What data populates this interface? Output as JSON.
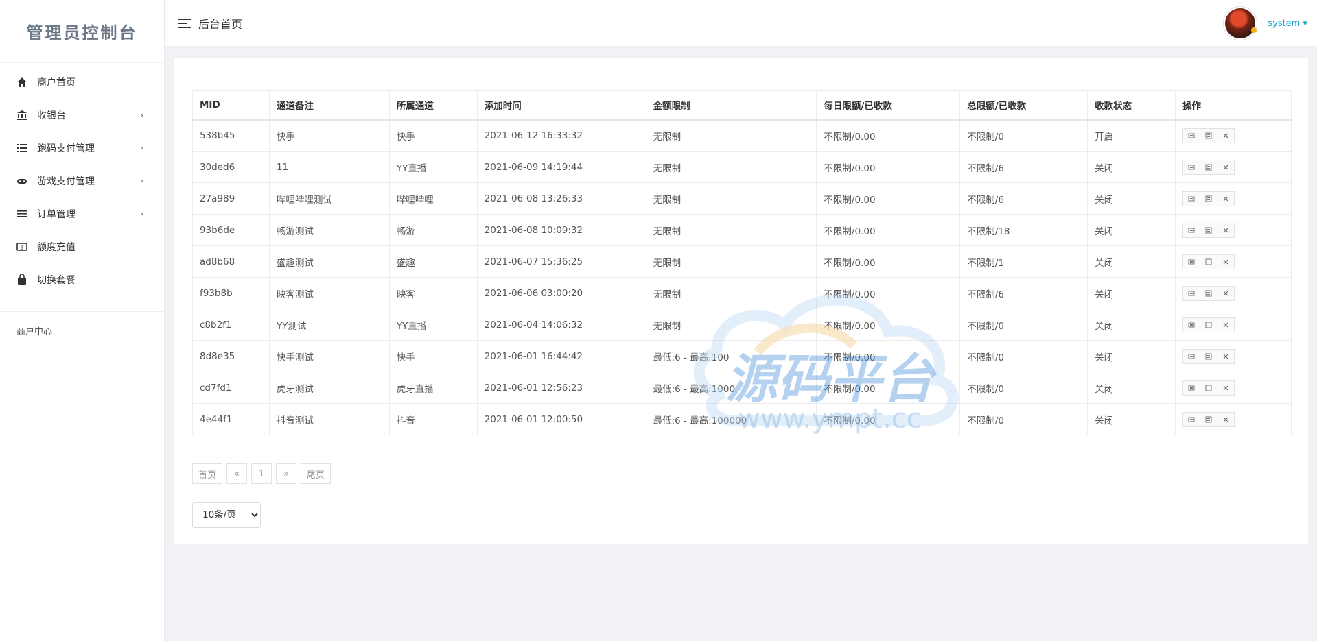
{
  "brand": {
    "title": "管理员控制台"
  },
  "header": {
    "title": "后台首页",
    "username": "system"
  },
  "sidebar": {
    "items": [
      {
        "label": "商户首页",
        "icon": "home-icon",
        "has_children": false
      },
      {
        "label": "收银台",
        "icon": "bank-icon",
        "has_children": true
      },
      {
        "label": "跑码支付管理",
        "icon": "list-icon",
        "has_children": true
      },
      {
        "label": "游戏支付管理",
        "icon": "gamepad-icon",
        "has_children": true
      },
      {
        "label": "订单管理",
        "icon": "menu-lines-icon",
        "has_children": true
      },
      {
        "label": "额度充值",
        "icon": "money-icon",
        "has_children": false
      },
      {
        "label": "切换套餐",
        "icon": "bag-icon",
        "has_children": false
      }
    ],
    "section_label": "商户中心",
    "chevron": "›"
  },
  "table": {
    "columns": [
      "MID",
      "通道备注",
      "所属通道",
      "添加时间",
      "金额限制",
      "每日限额/已收款",
      "总限额/已收款",
      "收款状态",
      "操作"
    ],
    "rows": [
      {
        "mid": "538b45",
        "note": "快手",
        "channel": "快手",
        "time": "2021-06-12 16:33:32",
        "amount": "无限制",
        "daily": "不限制/0.00",
        "total": "不限制/0",
        "status": "开启",
        "status_on": true
      },
      {
        "mid": "30ded6",
        "note": "11",
        "channel": "YY直播",
        "time": "2021-06-09 14:19:44",
        "amount": "无限制",
        "daily": "不限制/0.00",
        "total": "不限制/6",
        "status": "关闭",
        "status_on": false
      },
      {
        "mid": "27a989",
        "note": "哔哩哔哩测试",
        "channel": "哔哩哔哩",
        "time": "2021-06-08 13:26:33",
        "amount": "无限制",
        "daily": "不限制/0.00",
        "total": "不限制/6",
        "status": "关闭",
        "status_on": false
      },
      {
        "mid": "93b6de",
        "note": "畅游测试",
        "channel": "畅游",
        "time": "2021-06-08 10:09:32",
        "amount": "无限制",
        "daily": "不限制/0.00",
        "total": "不限制/18",
        "status": "关闭",
        "status_on": false
      },
      {
        "mid": "ad8b68",
        "note": "盛趣测试",
        "channel": "盛趣",
        "time": "2021-06-07 15:36:25",
        "amount": "无限制",
        "daily": "不限制/0.00",
        "total": "不限制/1",
        "status": "关闭",
        "status_on": false
      },
      {
        "mid": "f93b8b",
        "note": "映客测试",
        "channel": "映客",
        "time": "2021-06-06 03:00:20",
        "amount": "无限制",
        "daily": "不限制/0.00",
        "total": "不限制/6",
        "status": "关闭",
        "status_on": false
      },
      {
        "mid": "c8b2f1",
        "note": "YY测试",
        "channel": "YY直播",
        "time": "2021-06-04 14:06:32",
        "amount": "无限制",
        "daily": "不限制/0.00",
        "total": "不限制/0",
        "status": "关闭",
        "status_on": false
      },
      {
        "mid": "8d8e35",
        "note": "快手测试",
        "channel": "快手",
        "time": "2021-06-01 16:44:42",
        "amount": "最低:6 - 最高:100",
        "daily": "不限制/0.00",
        "total": "不限制/0",
        "status": "关闭",
        "status_on": false
      },
      {
        "mid": "cd7fd1",
        "note": "虎牙测试",
        "channel": "虎牙直播",
        "time": "2021-06-01 12:56:23",
        "amount": "最低:6 - 最高:1000",
        "daily": "不限制/0.00",
        "total": "不限制/0",
        "status": "关闭",
        "status_on": false
      },
      {
        "mid": "4e44f1",
        "note": "抖音测试",
        "channel": "抖音",
        "time": "2021-06-01 12:00:50",
        "amount": "最低:6 - 最高:100000",
        "daily": "不限制/0.00",
        "total": "不限制/0",
        "status": "关闭",
        "status_on": false
      }
    ],
    "op_icons": [
      "edit-icon",
      "qrcode-icon",
      "delete-icon"
    ]
  },
  "pagination": {
    "first": "首页",
    "prev": "«",
    "current": "1",
    "next": "»",
    "last": "尾页",
    "page_size": "10条/页",
    "page_size_options": [
      "10条/页"
    ]
  },
  "watermark": {
    "text": "源码平台",
    "url": "www.ympt.cc"
  },
  "colors": {
    "accent": "#1ab394",
    "danger": "#ed5565",
    "link": "#18a3c8",
    "background": "#f0f2f5"
  }
}
